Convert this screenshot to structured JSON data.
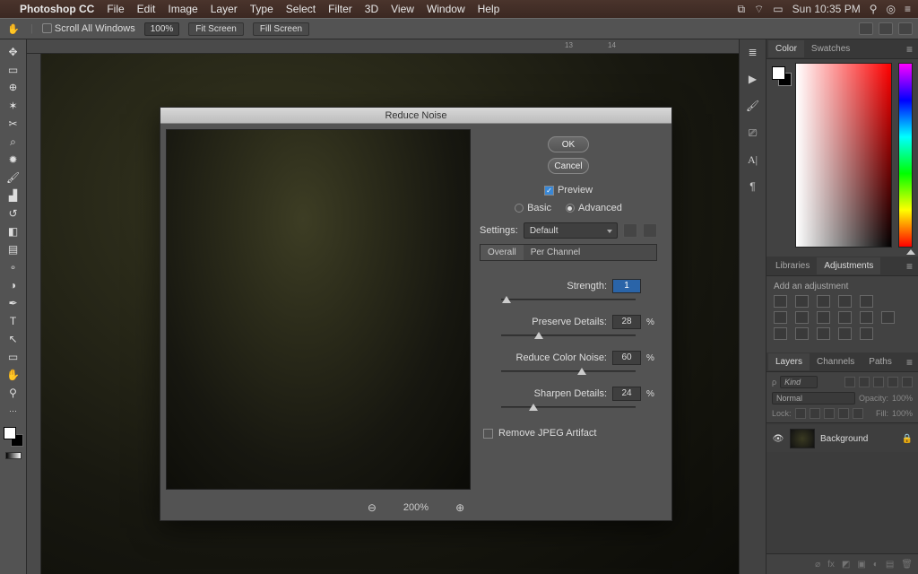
{
  "menubar": {
    "app": "Photoshop CC",
    "items": [
      "File",
      "Edit",
      "Image",
      "Layer",
      "Type",
      "Select",
      "Filter",
      "3D",
      "View",
      "Window",
      "Help"
    ],
    "clock": "Sun 10:35 PM"
  },
  "options_bar": {
    "scroll_all": "Scroll All Windows",
    "zoom_value": "100%",
    "fit_screen": "Fit Screen",
    "fill_screen": "Fill Screen"
  },
  "ruler": {
    "tick_13": "13",
    "tick_14": "14"
  },
  "dialog": {
    "title": "Reduce Noise",
    "ok": "OK",
    "cancel": "Cancel",
    "preview_label": "Preview",
    "preview_checked": true,
    "mode_basic": "Basic",
    "mode_advanced": "Advanced",
    "mode_selected": "Advanced",
    "settings_label": "Settings:",
    "settings_value": "Default",
    "subtabs": {
      "overall": "Overall",
      "per_channel": "Per Channel",
      "active": "Overall"
    },
    "sliders": {
      "strength": {
        "label": "Strength:",
        "value": "1",
        "pct": "",
        "pos": 4
      },
      "preserve": {
        "label": "Preserve Details:",
        "value": "28",
        "pct": "%",
        "pos": 28
      },
      "color_noise": {
        "label": "Reduce Color Noise:",
        "value": "60",
        "pct": "%",
        "pos": 60
      },
      "sharpen": {
        "label": "Sharpen Details:",
        "value": "24",
        "pct": "%",
        "pos": 24
      }
    },
    "jpeg_artifact": "Remove JPEG Artifact",
    "zoom_level": "200%"
  },
  "panels": {
    "color_tab": "Color",
    "swatches_tab": "Swatches",
    "libraries_tab": "Libraries",
    "adjustments_tab": "Adjustments",
    "add_adjustment": "Add an adjustment",
    "layers_tab": "Layers",
    "channels_tab": "Channels",
    "paths_tab": "Paths",
    "layer_filter": "Kind",
    "blend_mode": "Normal",
    "opacity_label": "Opacity:",
    "opacity_value": "100%",
    "lock_label": "Lock:",
    "fill_label": "Fill:",
    "fill_value": "100%",
    "background_layer": "Background"
  }
}
